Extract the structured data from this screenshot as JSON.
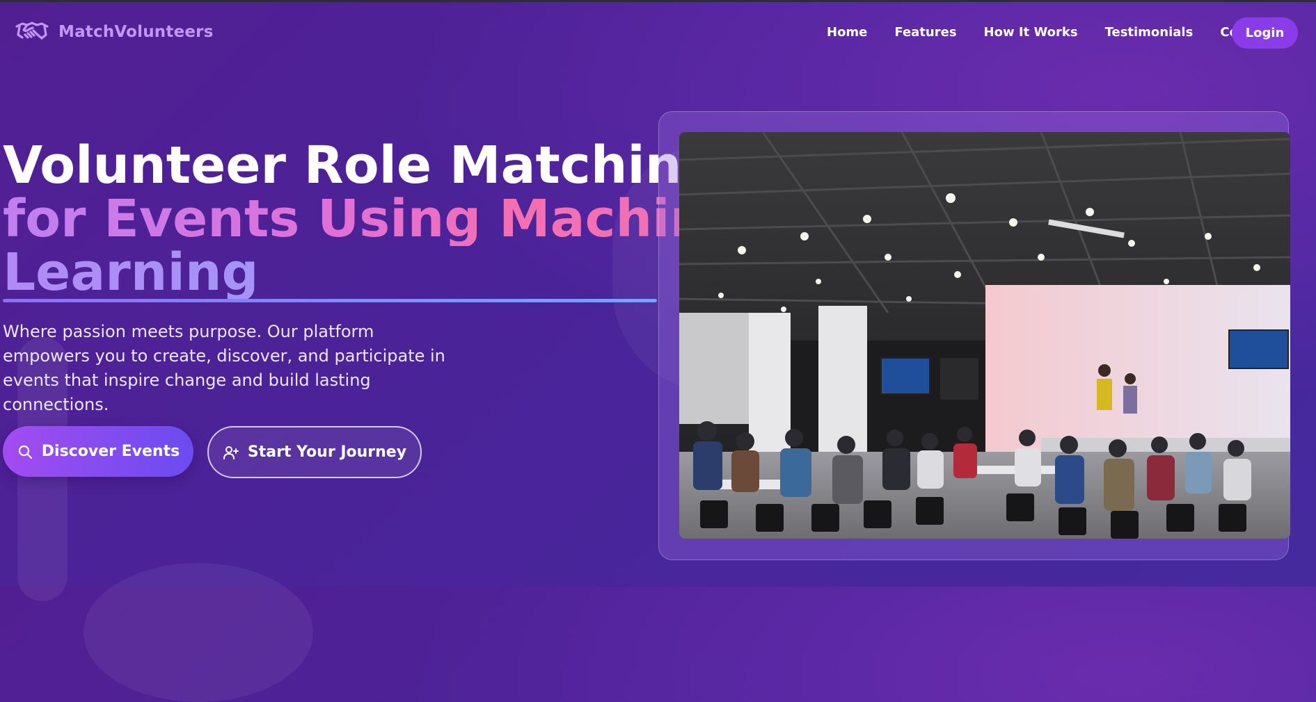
{
  "nav": {
    "brand": "MatchVolunteers",
    "links": [
      "Home",
      "Features",
      "How It Works",
      "Testimonials",
      "Contact"
    ],
    "login": "Login"
  },
  "hero": {
    "title_line1": "Volunteer Role Matching",
    "title_line2": "for Events Using Machine",
    "title_line3": "Learning",
    "subtitle": "Where passion meets purpose. Our platform empowers you to create, discover, and participate in events that inspire change and build lasting connections.",
    "primary_cta": "Discover Events",
    "secondary_cta": "Start Your Journey"
  },
  "icons": {
    "brand": "handshake-icon",
    "primary_cta": "search-icon",
    "secondary_cta": "user-plus-icon"
  },
  "colors": {
    "brand_text": "#c597f5",
    "login_button": "#8b3ce9",
    "primary_gradient_start": "#a24cf0",
    "primary_gradient_end": "#6a4cf0"
  }
}
